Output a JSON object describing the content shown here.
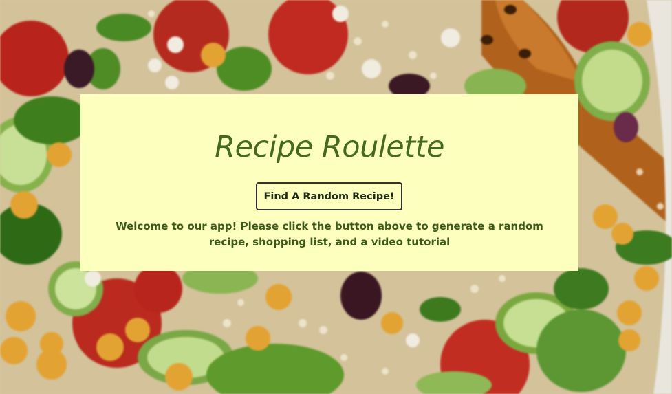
{
  "app": {
    "title": "Recipe Roulette",
    "button_label": "Find A Random Recipe!",
    "welcome_text": "Welcome to our app! Please click the button above to generate a random recipe, shopping list, and a video tutorial"
  },
  "colors": {
    "card_background": "#fdffbf",
    "title": "#45691e",
    "text": "#3b5a18"
  },
  "background": {
    "image": "salad-photo"
  }
}
